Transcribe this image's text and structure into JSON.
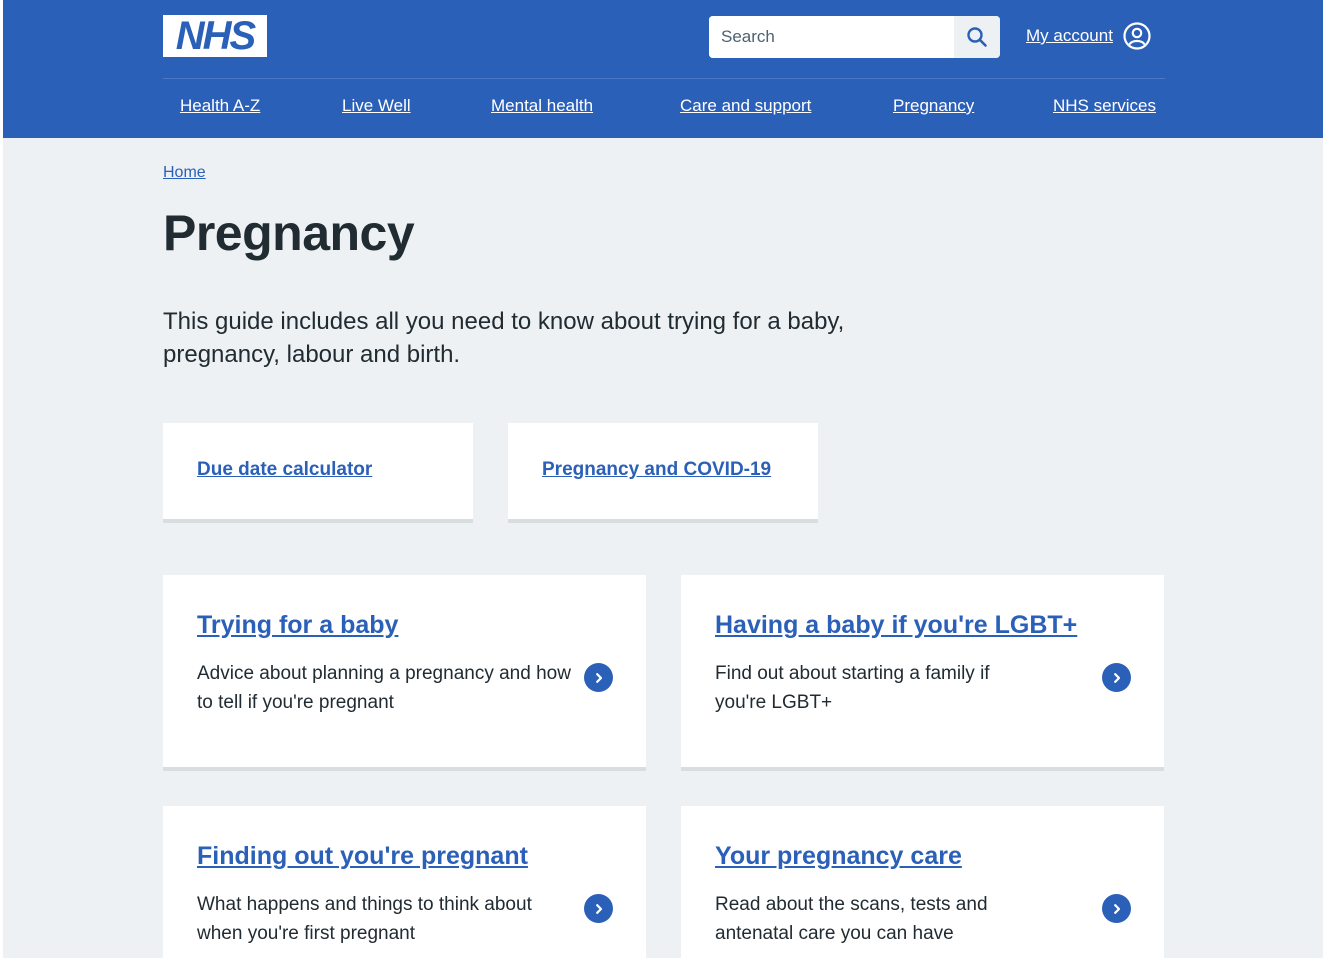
{
  "header": {
    "logo_text": "NHS",
    "search": {
      "placeholder": "Search",
      "value": ""
    },
    "account_label": "My account",
    "nav": [
      "Health A-Z",
      "Live Well",
      "Mental health",
      "Care and support",
      "Pregnancy",
      "NHS services"
    ]
  },
  "breadcrumb": {
    "home": "Home"
  },
  "page": {
    "title": "Pregnancy",
    "lede": "This guide includes all you need to know about trying for a baby, pregnancy, labour and birth."
  },
  "quick_links": [
    "Due date calculator",
    "Pregnancy and COVID-19"
  ],
  "cards": [
    {
      "title": "Trying for a baby",
      "description": "Advice about planning a pregnancy and how to tell if you're pregnant"
    },
    {
      "title": "Having a baby if you're LGBT+",
      "description": "Find out about starting a family if you're LGBT+"
    },
    {
      "title": "Finding out you're pregnant",
      "description": "What happens and things to think about when you're first pregnant"
    },
    {
      "title": "Your pregnancy care",
      "description": "Read about the scans, tests and antenatal care you can have"
    }
  ],
  "colors": {
    "brand_blue": "#2b60b8",
    "page_bg": "#eef1f3",
    "text": "#212b32",
    "card_border": "#d8dde0"
  },
  "icons": {
    "search": "search-icon",
    "account": "user-circle-icon",
    "card_link": "chevron-right-circle-icon"
  }
}
